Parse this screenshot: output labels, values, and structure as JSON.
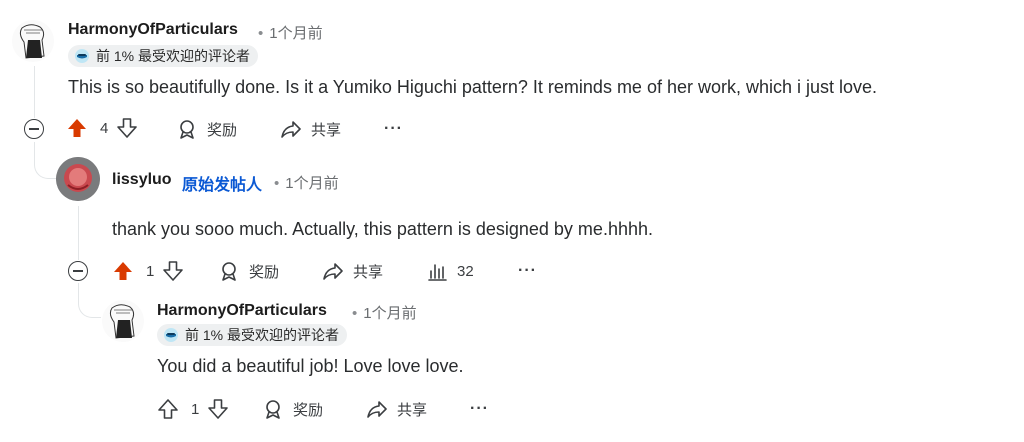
{
  "comments": [
    {
      "username": "HarmonyOfParticulars",
      "time": "1个月前",
      "badge": "前 1% 最受欢迎的评论者",
      "text": "This is so beautifully done. Is it a Yumiko Higuchi pattern? It reminds me of her work, which i just love.",
      "score": "4",
      "award_label": "奖励",
      "share_label": "共享",
      "more_label": "···"
    },
    {
      "username": "lissyluo",
      "op_tag": "原始发帖人",
      "time": "1个月前",
      "text": "thank you sooo much. Actually, this pattern is designed by me.hhhh.",
      "score": "1",
      "award_label": "奖励",
      "share_label": "共享",
      "insights_count": "32",
      "more_label": "···"
    },
    {
      "username": "HarmonyOfParticulars",
      "time": "1个月前",
      "badge": "前 1% 最受欢迎的评论者",
      "text": "You did a beautiful job! Love love love.",
      "score": "1",
      "award_label": "奖励",
      "share_label": "共享",
      "more_label": "···"
    }
  ],
  "colors": {
    "upvote_active": "#d93a00",
    "op_tag": "#0b59d4",
    "thread_line": "#e3e6e8"
  }
}
